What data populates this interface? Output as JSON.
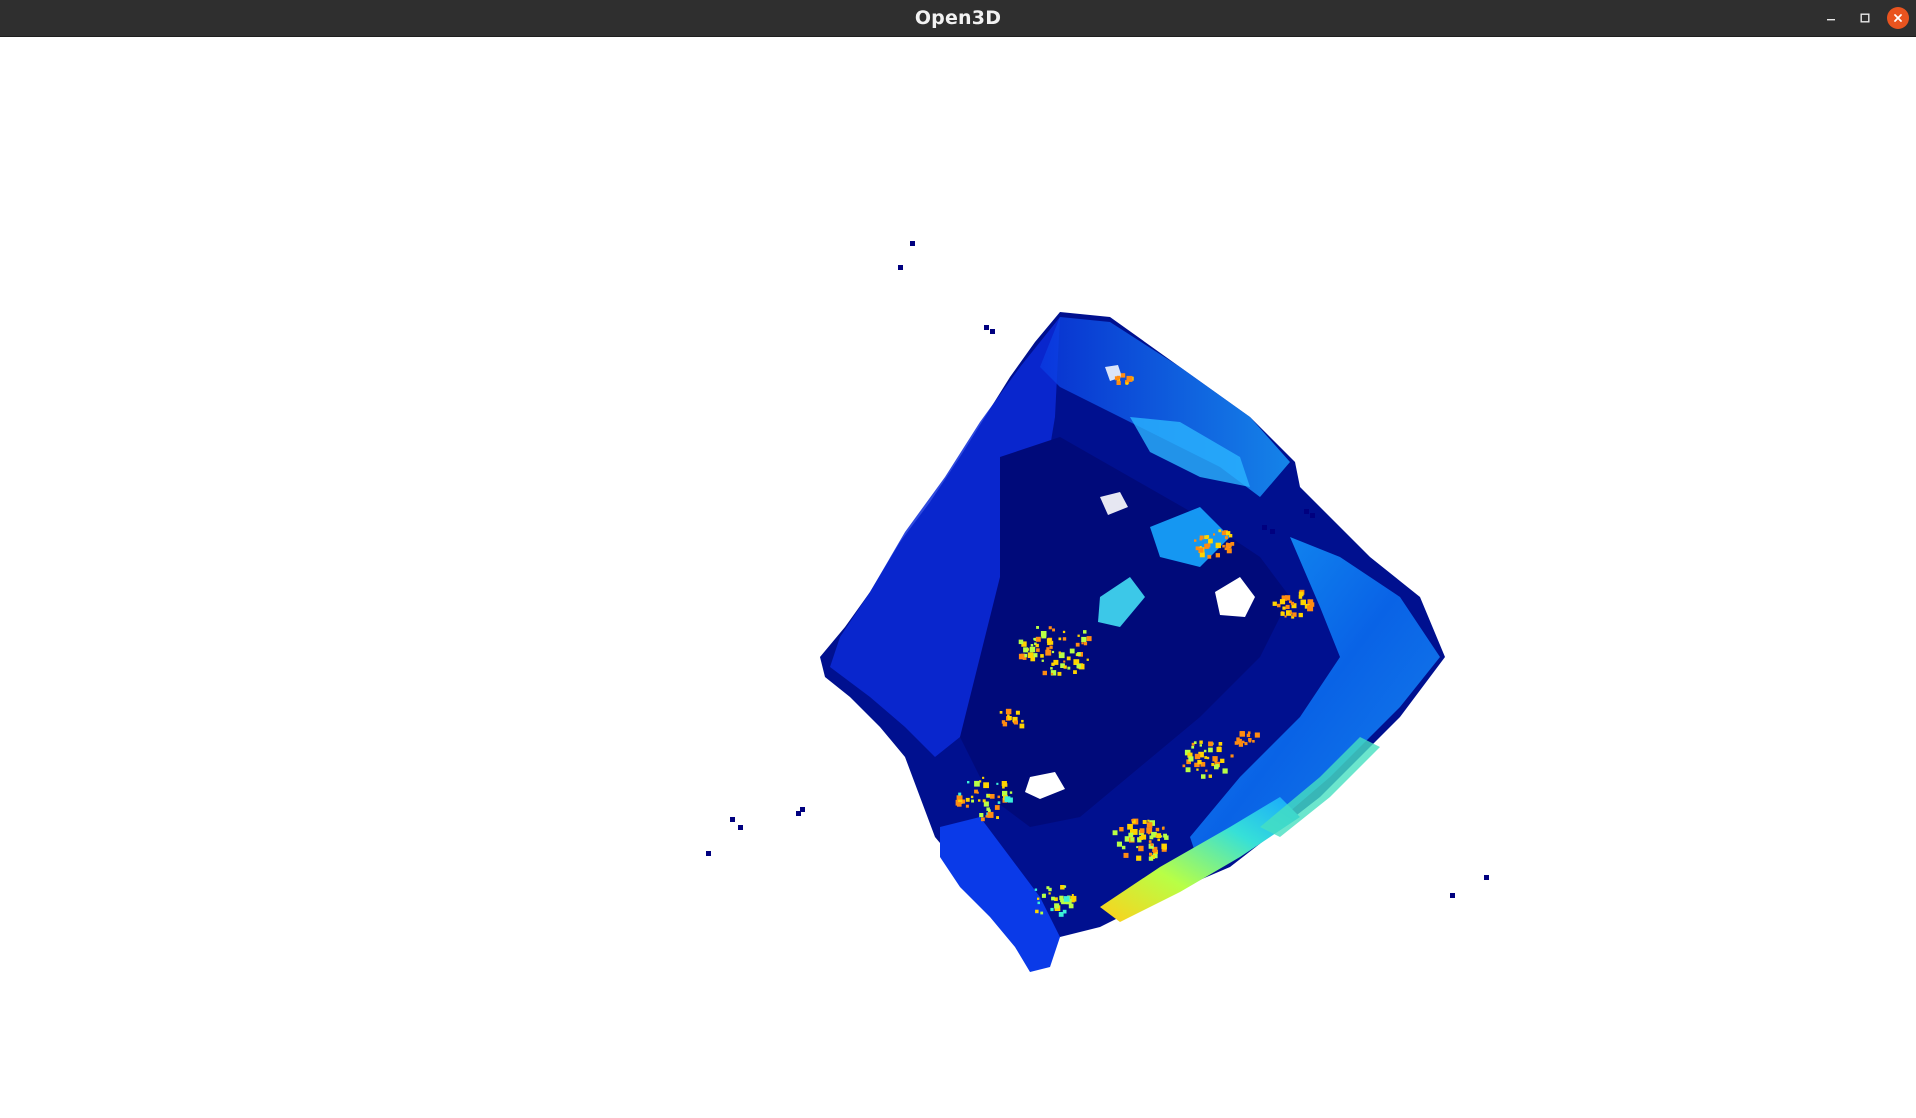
{
  "window": {
    "title": "Open3D",
    "controls": {
      "minimize_icon": "minimize-icon",
      "maximize_icon": "maximize-icon",
      "close_icon": "close-icon"
    }
  },
  "viewport": {
    "content": "point-cloud",
    "background_color": "#ffffff",
    "colormap": [
      "#00007f",
      "#0000d8",
      "#0a4cff",
      "#17a6ff",
      "#3cf0d8",
      "#b8ff46",
      "#ffd400",
      "#ff8c12",
      "#e63b0a"
    ]
  }
}
